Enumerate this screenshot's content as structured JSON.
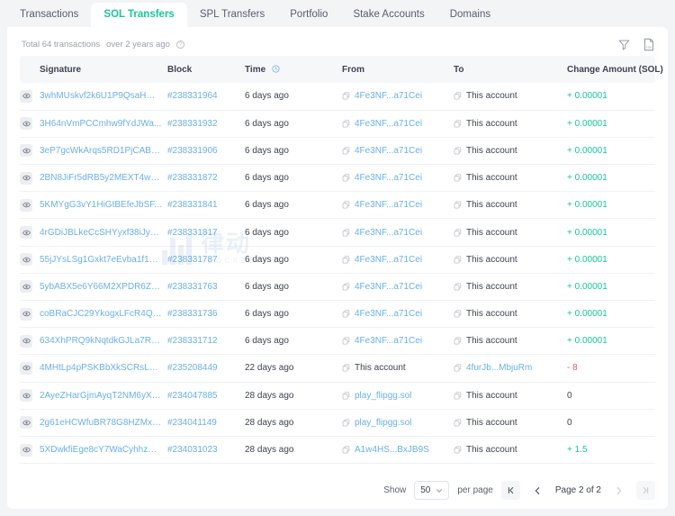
{
  "tabs": [
    {
      "label": "Transactions",
      "active": false
    },
    {
      "label": "SOL Transfers",
      "active": true
    },
    {
      "label": "SPL Transfers",
      "active": false
    },
    {
      "label": "Portfolio",
      "active": false
    },
    {
      "label": "Stake Accounts",
      "active": false
    },
    {
      "label": "Domains",
      "active": false
    }
  ],
  "summary": {
    "total_text": "Total 64 transactions",
    "age_text": "over 2 years ago",
    "help_icon": "question-circle-icon"
  },
  "toolbar": {
    "filter_icon": "filter-funnel-icon",
    "export_icon": "csv-download-icon",
    "export_label": "csv"
  },
  "table": {
    "columns": [
      "Signature",
      "Block",
      "Time",
      "From",
      "To",
      "Change Amount (SOL)"
    ],
    "time_icon": "clock-icon",
    "rows": [
      {
        "signature": "3whMUskvf2k6U1P9QsaHGy...",
        "block": "#238331964",
        "time": "6 days ago",
        "from": "4Fe3NF...a71Cei",
        "from_link": true,
        "to": "This account",
        "to_link": false,
        "amount": "+ 0.00001",
        "amount_sign": "pos"
      },
      {
        "signature": "3H64nVmPCCmhw9fYdJWa...",
        "block": "#238331932",
        "time": "6 days ago",
        "from": "4Fe3NF...a71Cei",
        "from_link": true,
        "to": "This account",
        "to_link": false,
        "amount": "+ 0.00001",
        "amount_sign": "pos"
      },
      {
        "signature": "3eP7gcWkArqs5RD1PjCABQ...",
        "block": "#238331906",
        "time": "6 days ago",
        "from": "4Fe3NF...a71Cei",
        "from_link": true,
        "to": "This account",
        "to_link": false,
        "amount": "+ 0.00001",
        "amount_sign": "pos"
      },
      {
        "signature": "2BN8JiFr5dRB5y2MEXT4wb...",
        "block": "#238331872",
        "time": "6 days ago",
        "from": "4Fe3NF...a71Cei",
        "from_link": true,
        "to": "This account",
        "to_link": false,
        "amount": "+ 0.00001",
        "amount_sign": "pos"
      },
      {
        "signature": "5KMYgG3vY1HiGtBEfeJbSF...",
        "block": "#238331841",
        "time": "6 days ago",
        "from": "4Fe3NF...a71Cei",
        "from_link": true,
        "to": "This account",
        "to_link": false,
        "amount": "+ 0.00001",
        "amount_sign": "pos"
      },
      {
        "signature": "4rGDiJBLkeCcSHYyxf38iJyK...",
        "block": "#238331817",
        "time": "6 days ago",
        "from": "4Fe3NF...a71Cei",
        "from_link": true,
        "to": "This account",
        "to_link": false,
        "amount": "+ 0.00001",
        "amount_sign": "pos"
      },
      {
        "signature": "55jJYsLSg1Gxkt7eEvba1f1M...",
        "block": "#238331787",
        "time": "6 days ago",
        "from": "4Fe3NF...a71Cei",
        "from_link": true,
        "to": "This account",
        "to_link": false,
        "amount": "+ 0.00001",
        "amount_sign": "pos"
      },
      {
        "signature": "5ybABX5e6Y66M2XPDR6Zc...",
        "block": "#238331763",
        "time": "6 days ago",
        "from": "4Fe3NF...a71Cei",
        "from_link": true,
        "to": "This account",
        "to_link": false,
        "amount": "+ 0.00001",
        "amount_sign": "pos"
      },
      {
        "signature": "coBRaCJC29YkogxLFcR4Qp...",
        "block": "#238331736",
        "time": "6 days ago",
        "from": "4Fe3NF...a71Cei",
        "from_link": true,
        "to": "This account",
        "to_link": false,
        "amount": "+ 0.00001",
        "amount_sign": "pos"
      },
      {
        "signature": "634XhPRQ9kNqtdkGJLa7Rz...",
        "block": "#238331712",
        "time": "6 days ago",
        "from": "4Fe3NF...a71Cei",
        "from_link": true,
        "to": "This account",
        "to_link": false,
        "amount": "+ 0.00001",
        "amount_sign": "pos"
      },
      {
        "signature": "4MHtLp4pPSKBbXkSCRsLnf...",
        "block": "#235208449",
        "time": "22 days ago",
        "from": "This account",
        "from_link": false,
        "to": "4furJb...MbjuRm",
        "to_link": true,
        "amount": "- 8",
        "amount_sign": "neg"
      },
      {
        "signature": "2AyeZHarGjmAyqT2NM6yX5...",
        "block": "#234047885",
        "time": "28 days ago",
        "from": "play_flipgg.sol",
        "from_link": true,
        "to": "This account",
        "to_link": false,
        "amount": "0",
        "amount_sign": "zero"
      },
      {
        "signature": "2g61eHCWfuBR78G8HZMxvi...",
        "block": "#234041149",
        "time": "28 days ago",
        "from": "play_flipgg.sol",
        "from_link": true,
        "to": "This account",
        "to_link": false,
        "amount": "0",
        "amount_sign": "zero"
      },
      {
        "signature": "5XDwkfiEge8cY7WaCyhhzSc...",
        "block": "#234031023",
        "time": "28 days ago",
        "from": "A1w4HS...BxJB9S",
        "from_link": true,
        "to": "This account",
        "to_link": false,
        "amount": "+ 1.5",
        "amount_sign": "pos"
      }
    ]
  },
  "pagination": {
    "show_label": "Show",
    "page_size": "50",
    "per_page_label": "per page",
    "first_icon": "first-page-icon",
    "prev_icon": "chevron-left-icon",
    "page_label": "Page 2 of 2",
    "next_icon": "chevron-right-icon",
    "last_icon": "last-page-icon"
  },
  "watermark": {
    "text": "律动",
    "sub": "BLOCKBEATS"
  },
  "colors": {
    "accent_green": "#16c79a",
    "link_blue": "#6ab0e8",
    "negative_red": "#e35b5b",
    "page_bg": "#f3f4f6"
  }
}
